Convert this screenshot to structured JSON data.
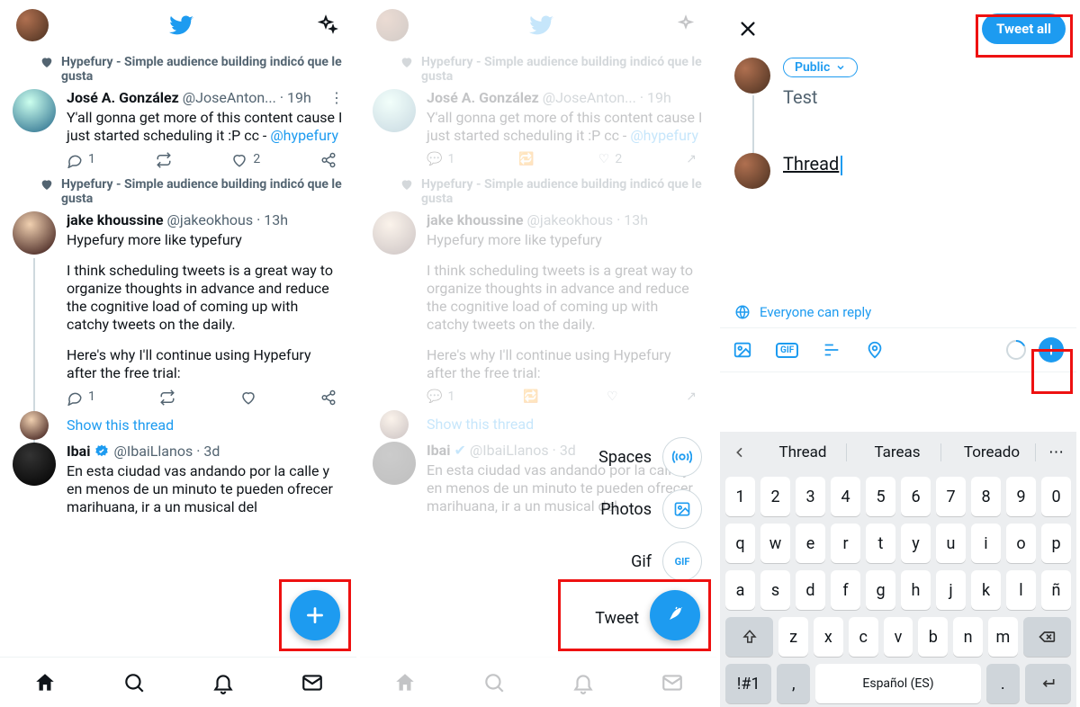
{
  "colors": {
    "accent": "#1d9bf0",
    "highlight": "#e11"
  },
  "like_banner": "Hypefury - Simple audience building indicó que le gusta",
  "tweets": [
    {
      "name": "José A. González",
      "handle": "@JoseAnton...",
      "time": "19h",
      "text": "Y'all gonna get more of this content cause I just started scheduling it :P  cc -",
      "mention": "@hypefury",
      "replies": "1",
      "likes": "2"
    },
    {
      "name": "jake khoussine",
      "handle": "@jakeokhous",
      "time": "13h",
      "line1": "Hypefury more like typefury",
      "line2": "I think scheduling tweets is a great way to organize thoughts in advance and reduce the cognitive load of coming up with catchy tweets on the daily.",
      "line3": "Here's why I'll continue using Hypefury after the free trial:",
      "replies": "1"
    },
    {
      "name": "Ibai",
      "handle": "@IbaiLlanos",
      "time": "3d",
      "text": "En esta ciudad vas andando por la calle y en menos de un minuto te pueden ofrecer marihuana, ir a un musical del"
    }
  ],
  "show_thread": "Show this thread",
  "fab_menu": {
    "spaces": "Spaces",
    "photos": "Photos",
    "gif": "Gif",
    "tweet": "Tweet"
  },
  "compose": {
    "tweet_all": "Tweet all",
    "audience": "Public",
    "tweet1": "Test",
    "tweet2": "Thread",
    "reply_scope": "Everyone can reply"
  },
  "keyboard": {
    "suggestions": [
      "Thread",
      "Tareas",
      "Toreado"
    ],
    "row1": [
      "1",
      "2",
      "3",
      "4",
      "5",
      "6",
      "7",
      "8",
      "9",
      "0"
    ],
    "row2": [
      "q",
      "w",
      "e",
      "r",
      "t",
      "y",
      "u",
      "i",
      "o",
      "p"
    ],
    "row3": [
      "a",
      "s",
      "d",
      "f",
      "g",
      "h",
      "j",
      "k",
      "l",
      "ñ"
    ],
    "row4": [
      "z",
      "x",
      "c",
      "v",
      "b",
      "n",
      "m"
    ],
    "space_label": "Español (ES)",
    "symkey": "!#1"
  }
}
